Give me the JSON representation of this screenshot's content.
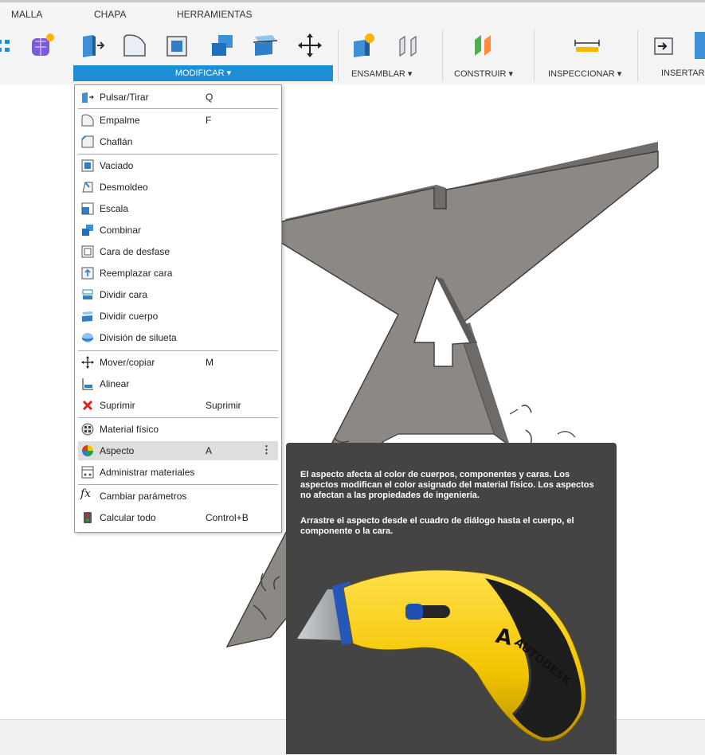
{
  "tabs": [
    "MALLA",
    "CHAPA",
    "HERRAMIENTAS"
  ],
  "ribbon": {
    "groups": {
      "modificar": "MODIFICAR ▾",
      "ensamblar": "ENSAMBLAR ▾",
      "construir": "CONSTRUIR ▾",
      "inspeccionar": "INSPECCIONAR ▾",
      "insertar": "INSERTAR"
    },
    "icons": [
      "grid-icon",
      "form-cube-icon",
      "press-pull-icon",
      "fillet-icon",
      "shell-icon",
      "combine-icon",
      "split-body-icon",
      "move-icon",
      "new-component-icon",
      "joint-icon",
      "offset-plane-icon",
      "measure-icon",
      "insert-icon"
    ]
  },
  "menu": {
    "items": [
      {
        "label": "Pulsar/Tirar",
        "shortcut": "Q",
        "icon": "press-pull-icon"
      },
      {
        "label": "Empalme",
        "shortcut": "F",
        "icon": "fillet-icon"
      },
      {
        "label": "Chaflán",
        "shortcut": "",
        "icon": "chamfer-icon"
      },
      {
        "label": "Vaciado",
        "shortcut": "",
        "icon": "shell-icon"
      },
      {
        "label": "Desmoldeo",
        "shortcut": "",
        "icon": "draft-icon"
      },
      {
        "label": "Escala",
        "shortcut": "",
        "icon": "scale-icon"
      },
      {
        "label": "Combinar",
        "shortcut": "",
        "icon": "combine-icon"
      },
      {
        "label": "Cara de desfase",
        "shortcut": "",
        "icon": "offset-face-icon"
      },
      {
        "label": "Reemplazar cara",
        "shortcut": "",
        "icon": "replace-face-icon"
      },
      {
        "label": "Dividir cara",
        "shortcut": "",
        "icon": "split-face-icon"
      },
      {
        "label": "Dividir cuerpo",
        "shortcut": "",
        "icon": "split-body-icon"
      },
      {
        "label": "División de silueta",
        "shortcut": "",
        "icon": "silhouette-split-icon"
      },
      {
        "label": "Mover/copiar",
        "shortcut": "M",
        "icon": "move-icon"
      },
      {
        "label": "Alinear",
        "shortcut": "",
        "icon": "align-icon"
      },
      {
        "label": "Suprimir",
        "shortcut": "Suprimir",
        "icon": "delete-icon"
      },
      {
        "label": "Material físico",
        "shortcut": "",
        "icon": "physical-material-icon"
      },
      {
        "label": "Aspecto",
        "shortcut": "A",
        "icon": "appearance-icon"
      },
      {
        "label": "Administrar materiales",
        "shortcut": "",
        "icon": "manage-materials-icon"
      },
      {
        "label": "Cambiar parámetros",
        "shortcut": "",
        "icon": "fx-parameters-icon"
      },
      {
        "label": "Calcular todo",
        "shortcut": "Control+B",
        "icon": "compute-all-icon"
      }
    ]
  },
  "tooltip": {
    "p1": "El aspecto afecta al color de cuerpos, componentes y caras. Los aspectos modifican el color asignado del material físico. Los aspectos no afectan a las propiedades de ingeniería.",
    "p2": "Arrastre el aspecto desde el cuadro de diálogo hasta el cuerpo, el componente o la cara.",
    "brand": "AUTODESK"
  },
  "colors": {
    "accent": "#1d8ed4",
    "tooltip_bg": "#444444",
    "part": "#8c8884",
    "knife_yellow": "#f2c400"
  }
}
